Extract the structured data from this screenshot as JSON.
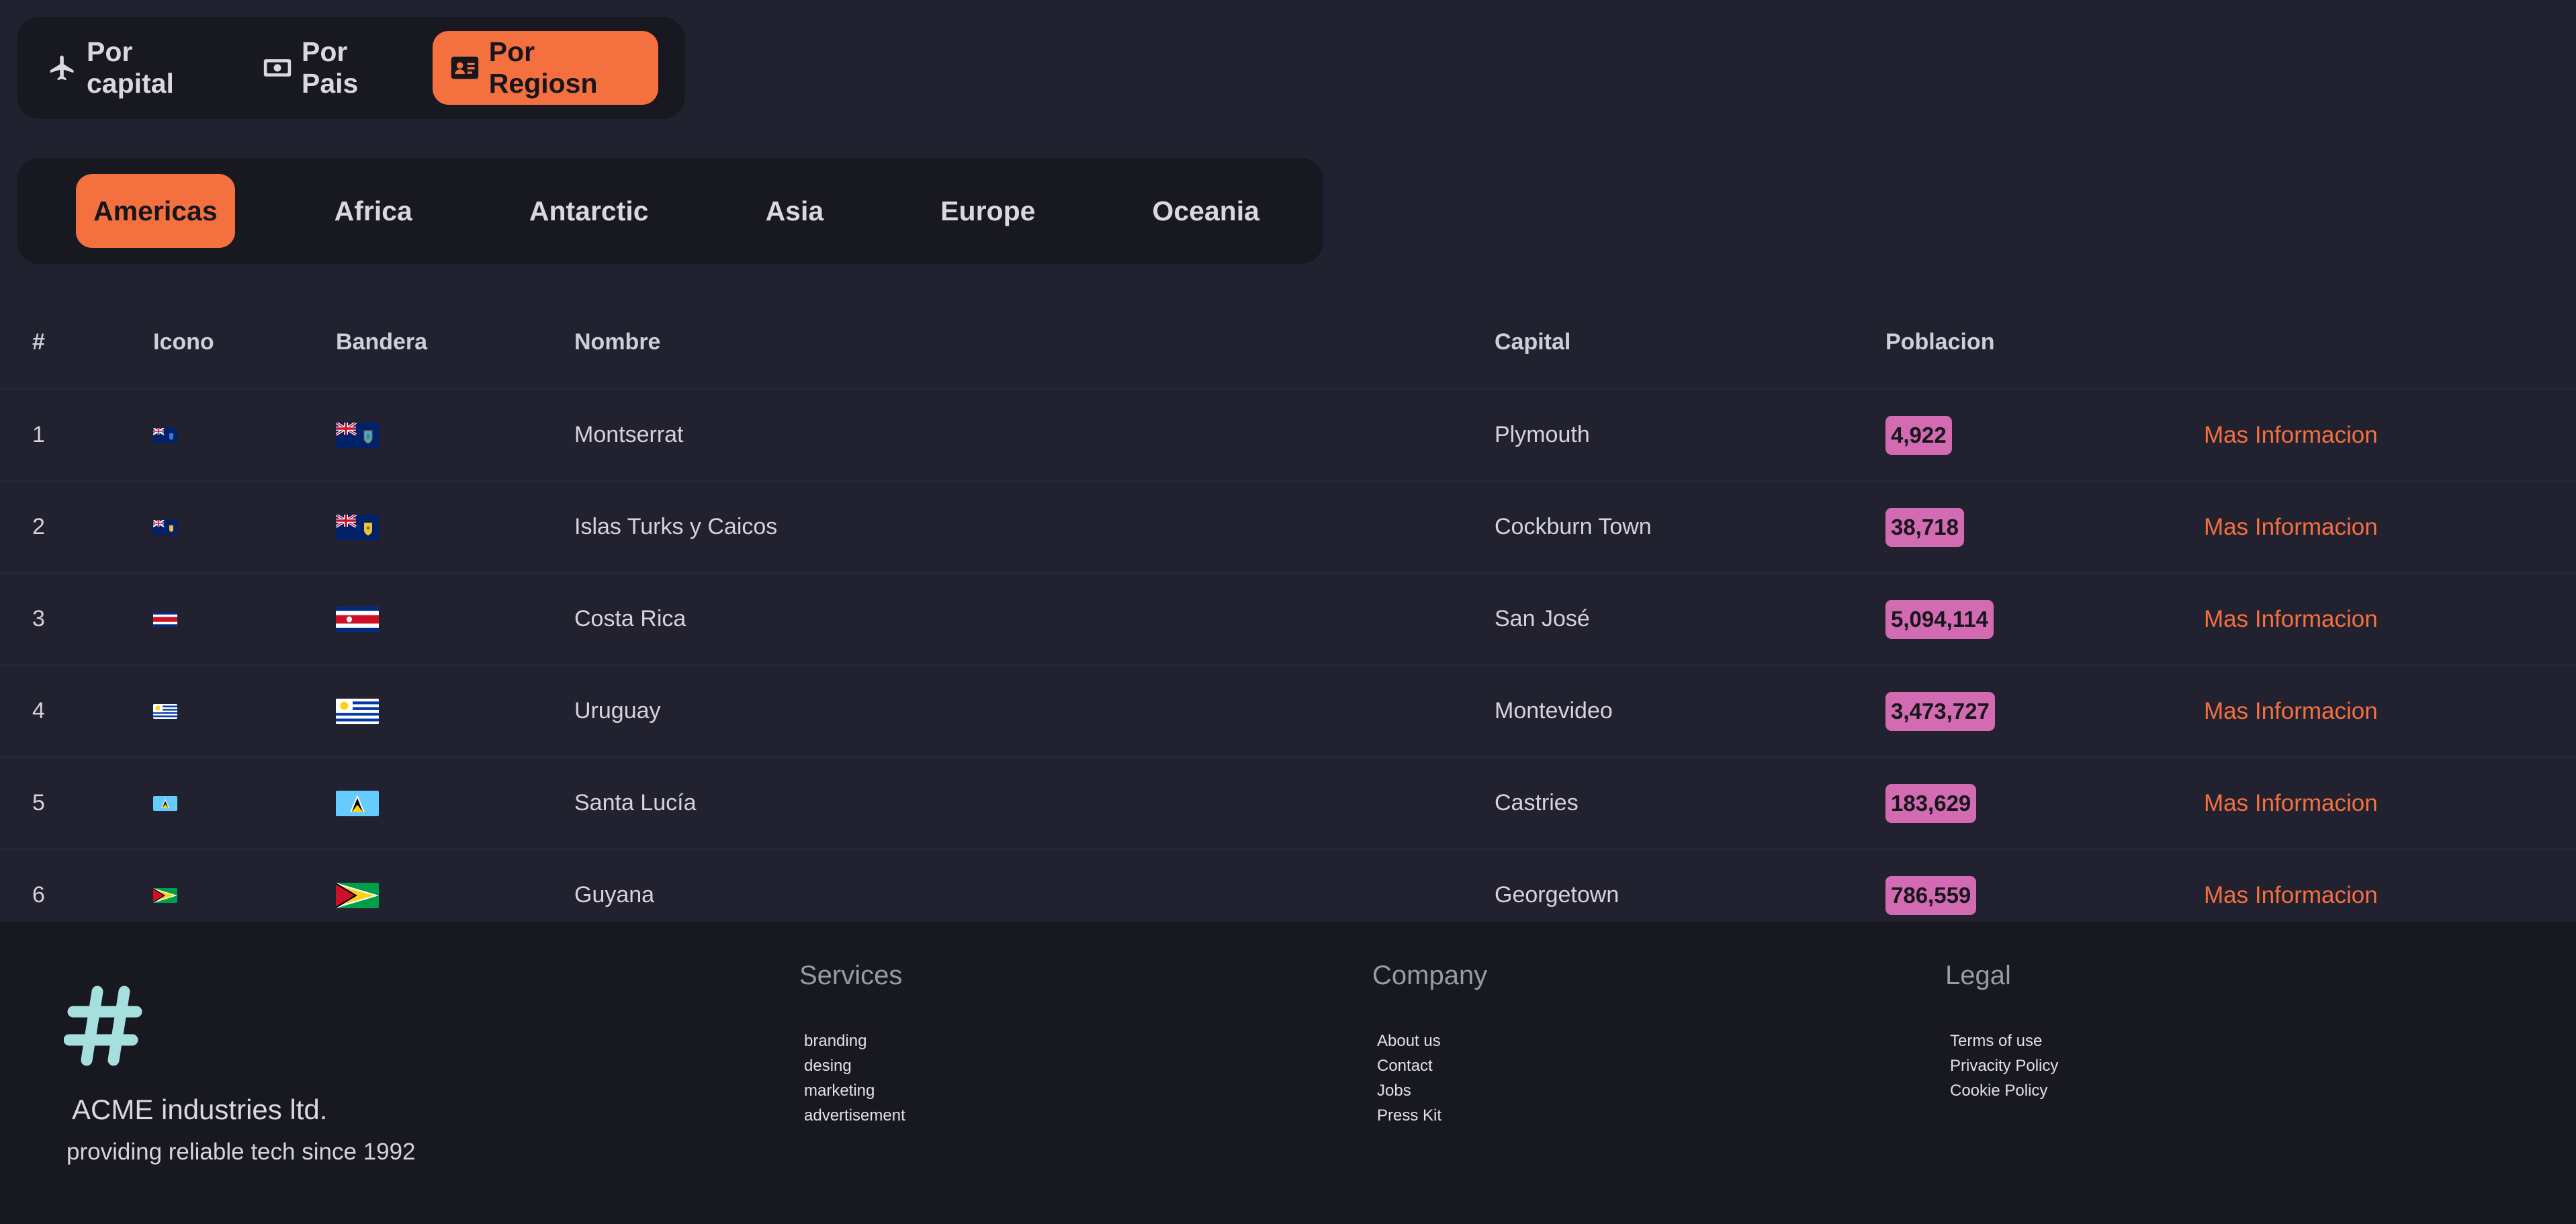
{
  "mode_tabs": [
    {
      "label": "Por capital",
      "icon": "plane-icon",
      "active": false
    },
    {
      "label": "Por Pais",
      "icon": "money-bill-icon",
      "active": false
    },
    {
      "label": "Por Regiosn",
      "icon": "id-card-icon",
      "active": true
    }
  ],
  "region_tabs": [
    {
      "label": "Americas",
      "active": true
    },
    {
      "label": "Africa",
      "active": false
    },
    {
      "label": "Antarctic",
      "active": false
    },
    {
      "label": "Asia",
      "active": false
    },
    {
      "label": "Europe",
      "active": false
    },
    {
      "label": "Oceania",
      "active": false
    }
  ],
  "table": {
    "headers": {
      "num": "#",
      "icon": "Icono",
      "flag": "Bandera",
      "name": "Nombre",
      "capital": "Capital",
      "population": "Poblacion"
    },
    "rows": [
      {
        "num": "1",
        "flag": "montserrat-flag-icon",
        "name": "Montserrat",
        "capital": "Plymouth",
        "population": "4,922",
        "link": "Mas Informacion"
      },
      {
        "num": "2",
        "flag": "turks-caicos-flag-icon",
        "name": "Islas Turks y Caicos",
        "capital": "Cockburn Town",
        "population": "38,718",
        "link": "Mas Informacion"
      },
      {
        "num": "3",
        "flag": "costa-rica-flag-icon",
        "name": "Costa Rica",
        "capital": "San José",
        "population": "5,094,114",
        "link": "Mas Informacion"
      },
      {
        "num": "4",
        "flag": "uruguay-flag-icon",
        "name": "Uruguay",
        "capital": "Montevideo",
        "population": "3,473,727",
        "link": "Mas Informacion"
      },
      {
        "num": "5",
        "flag": "saint-lucia-flag-icon",
        "name": "Santa Lucía",
        "capital": "Castries",
        "population": "183,629",
        "link": "Mas Informacion"
      },
      {
        "num": "6",
        "flag": "guyana-flag-icon",
        "name": "Guyana",
        "capital": "Georgetown",
        "population": "786,559",
        "link": "Mas Informacion"
      }
    ]
  },
  "footer": {
    "brand": "ACME industries ltd.",
    "tagline": "providing reliable tech since 1992",
    "logo_icon": "hashtag-icon",
    "columns": [
      {
        "title": "Services",
        "items": [
          "branding",
          "desing",
          "marketing",
          "advertisement"
        ]
      },
      {
        "title": "Company",
        "items": [
          "About us",
          "Contact",
          "Jobs",
          "Press Kit"
        ]
      },
      {
        "title": "Legal",
        "items": [
          "Terms of use",
          "Privacity Policy",
          "Cookie Policy"
        ]
      }
    ]
  },
  "colors": {
    "background": "#212130",
    "panel": "#181820",
    "accent": "#f5703f",
    "badge": "#d26bb2",
    "logo": "#a6e0de"
  }
}
